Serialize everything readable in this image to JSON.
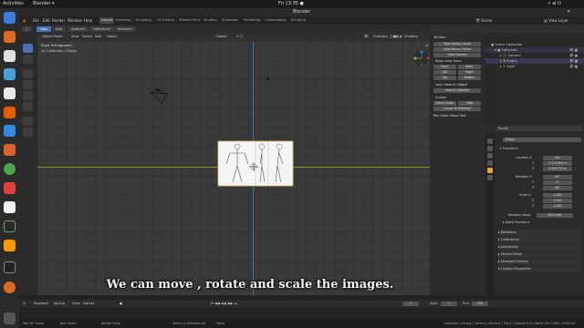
{
  "os": {
    "activities": "Activities",
    "app_name": "Blender ▾",
    "clock": "Fri 13:35 ●"
  },
  "window": {
    "title": "Blender"
  },
  "menubar": {
    "items": [
      "File",
      "Edit",
      "Render",
      "Window",
      "Help"
    ],
    "workspaces": [
      "Layout",
      "Modeling",
      "Sculpting",
      "UV Editing",
      "Texture Paint",
      "Shading",
      "Animation",
      "Rendering",
      "Compositing",
      "Scripting"
    ],
    "active_workspace": "Layout",
    "scene_label": "Scene",
    "view_layer_label": "View Layer"
  },
  "tool_header": {
    "buttons": [
      "New",
      "Add",
      "Subtract",
      "Difference",
      "Intersect"
    ],
    "active_button": "New"
  },
  "viewport_header": {
    "mode": "Object Mode",
    "menus": [
      "View",
      "Select",
      "Add",
      "Object"
    ],
    "orientation": "Global",
    "overlays": "Overlays",
    "shading": "Shading"
  },
  "viewport": {
    "view_name": "Right Orthographic",
    "collection_info": "(1) Collection | Empty",
    "axis_y_color": "#7f9a22",
    "axis_z_color": "#2b7ab5"
  },
  "npanel": {
    "nav_title": "3D-Nav",
    "buttons_view": [
      "View Global / Local",
      "View Persp / Ortho",
      "View Camera"
    ],
    "align_title": "Align view from:",
    "align_buttons": [
      [
        "Front",
        "Back"
      ],
      [
        "Left",
        "Right"
      ],
      [
        "Top",
        "Bottom"
      ]
    ],
    "lock_view": "Lock View to Object",
    "view_selected": "View to Selected",
    "cursor_title": "Cursor:",
    "cursor_buttons": [
      "World Origin",
      "View"
    ],
    "cursor_to_selected": "Cursor to Selected",
    "pan_orbit": "Pan Orbit Zoom Roll"
  },
  "outliner": {
    "title": "Scene Collection",
    "rows": [
      "Collection",
      "Camera",
      "Empty",
      "Light"
    ]
  },
  "properties": {
    "object_name": "Empty",
    "object_name_field": "Empty",
    "transform_title": "Transform",
    "location_label": "Location X",
    "location": [
      "0m",
      "0.111946 m",
      "0.190775 m"
    ],
    "rotation_label": "Rotation X",
    "rotation": [
      "90°",
      "0°",
      "90°"
    ],
    "scale_label": "Scale X",
    "scale": [
      "1.000",
      "1.000",
      "1.000"
    ],
    "axis_labels": [
      "Y",
      "Z"
    ],
    "rotation_mode_label": "Rotation Mode",
    "rotation_mode": "XYZ Euler",
    "delta_transform": "Delta Transform",
    "sections": [
      "Relations",
      "Collections",
      "Instancing",
      "Motion Paths",
      "Viewport Display",
      "Custom Properties"
    ]
  },
  "timeline": {
    "menus": [
      "Playback",
      "Keying",
      "View",
      "Marker"
    ],
    "frame": "1",
    "start_label": "Start",
    "start": "1",
    "end_label": "End",
    "end": "250"
  },
  "statusbar": {
    "left": [
      "Set 3D Cursor",
      "Box Select",
      "Rotate View",
      "Select or Deselect All",
      "Move"
    ],
    "right": "Collection | Empty | Verts:0 | Faces:0 | Tris:0 | Objects:1/3 | Mem: 63.7 MiB | v2.80.44"
  },
  "subtitle": "We  can move , rotate and scale the images."
}
